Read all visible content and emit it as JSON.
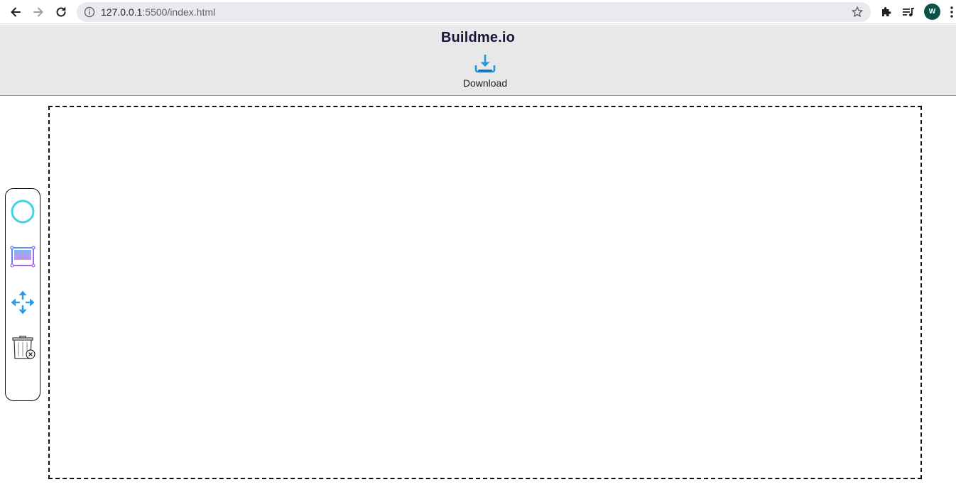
{
  "browser": {
    "url_host": "127.0.0.1",
    "url_rest": ":5500/index.html",
    "profile_initial": "W",
    "profile_color": "#0b5346"
  },
  "header": {
    "title": "Buildme.io",
    "download_label": "Download",
    "download_icon": "download-tray-icon",
    "background_color": "#e8e8e8"
  },
  "tools": [
    {
      "name": "circle-tool",
      "icon": "circle-outline-icon",
      "color": "#3fd3e3"
    },
    {
      "name": "rectangle-tool",
      "icon": "rectangle-select-icon",
      "color": "#8a7cf0"
    },
    {
      "name": "move-tool",
      "icon": "move-arrows-icon",
      "color": "#2a9bea"
    },
    {
      "name": "delete-tool",
      "icon": "trash-icon",
      "color": "#333333"
    }
  ],
  "canvas": {
    "border_style": "dashed",
    "border_color": "#111111"
  }
}
